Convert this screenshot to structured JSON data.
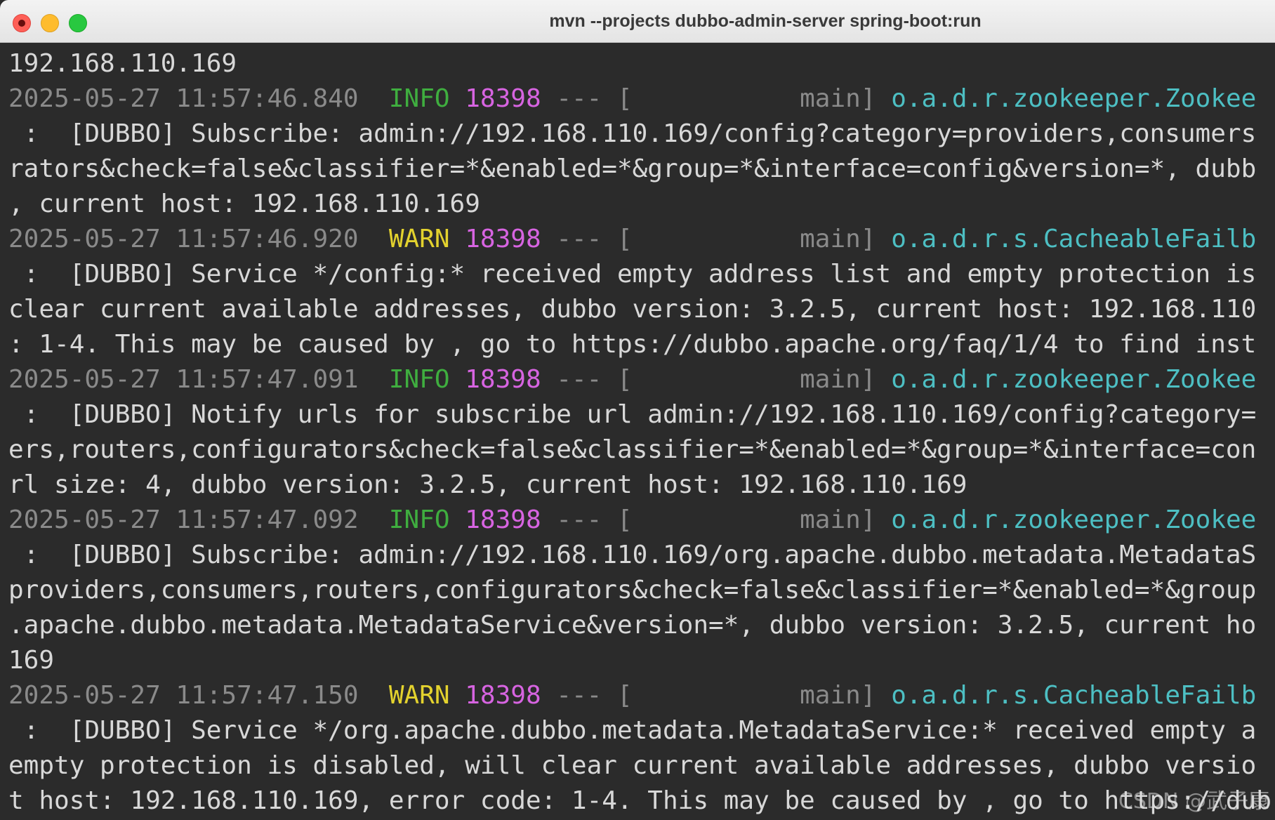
{
  "window": {
    "title": "mvn --projects dubbo-admin-server spring-boot:run"
  },
  "log": {
    "lines": [
      {
        "text": "192.168.110.169"
      },
      {
        "timestamp": "2025-05-27 11:57:46.840",
        "level": "INFO",
        "pid": "18398",
        "separator": "---",
        "thread": "[           main]",
        "logger": "o.a.d.r.zookeeper.Zookee"
      },
      {
        "text": " :  [DUBBO] Subscribe: admin://192.168.110.169/config?category=providers,consumers"
      },
      {
        "text": "rators&check=false&classifier=*&enabled=*&group=*&interface=config&version=*, dubb"
      },
      {
        "text": ", current host: 192.168.110.169"
      },
      {
        "timestamp": "2025-05-27 11:57:46.920",
        "level": "WARN",
        "pid": "18398",
        "separator": "---",
        "thread": "[           main]",
        "logger": "o.a.d.r.s.CacheableFailb"
      },
      {
        "text": " :  [DUBBO] Service */config:* received empty address list and empty protection is"
      },
      {
        "text": "clear current available addresses, dubbo version: 3.2.5, current host: 192.168.110"
      },
      {
        "text": ": 1-4. This may be caused by , go to https://dubbo.apache.org/faq/1/4 to find inst"
      },
      {
        "timestamp": "2025-05-27 11:57:47.091",
        "level": "INFO",
        "pid": "18398",
        "separator": "---",
        "thread": "[           main]",
        "logger": "o.a.d.r.zookeeper.Zookee"
      },
      {
        "text": " :  [DUBBO] Notify urls for subscribe url admin://192.168.110.169/config?category="
      },
      {
        "text": "ers,routers,configurators&check=false&classifier=*&enabled=*&group=*&interface=con"
      },
      {
        "text": "rl size: 4, dubbo version: 3.2.5, current host: 192.168.110.169"
      },
      {
        "timestamp": "2025-05-27 11:57:47.092",
        "level": "INFO",
        "pid": "18398",
        "separator": "---",
        "thread": "[           main]",
        "logger": "o.a.d.r.zookeeper.Zookee"
      },
      {
        "text": " :  [DUBBO] Subscribe: admin://192.168.110.169/org.apache.dubbo.metadata.MetadataS"
      },
      {
        "text": "providers,consumers,routers,configurators&check=false&classifier=*&enabled=*&group"
      },
      {
        "text": ".apache.dubbo.metadata.MetadataService&version=*, dubbo version: 3.2.5, current ho"
      },
      {
        "text": "169"
      },
      {
        "timestamp": "2025-05-27 11:57:47.150",
        "level": "WARN",
        "pid": "18398",
        "separator": "---",
        "thread": "[           main]",
        "logger": "o.a.d.r.s.CacheableFailb"
      },
      {
        "text": " :  [DUBBO] Service */org.apache.dubbo.metadata.MetadataService:* received empty a"
      },
      {
        "text": "empty protection is disabled, will clear current available addresses, dubbo versio"
      },
      {
        "text": "t host: 192.168.110.169, error code: 1-4. This may be caused by , go to https://dub"
      }
    ]
  },
  "watermark": "CSDN @武子康",
  "colors": {
    "background": "#2b2b2b",
    "text": "#d8d8d8",
    "timestamp": "#8a8a8a",
    "info": "#3fae3f",
    "warn": "#e3d22e",
    "pid": "#d764e1",
    "logger": "#4dbfc3"
  }
}
